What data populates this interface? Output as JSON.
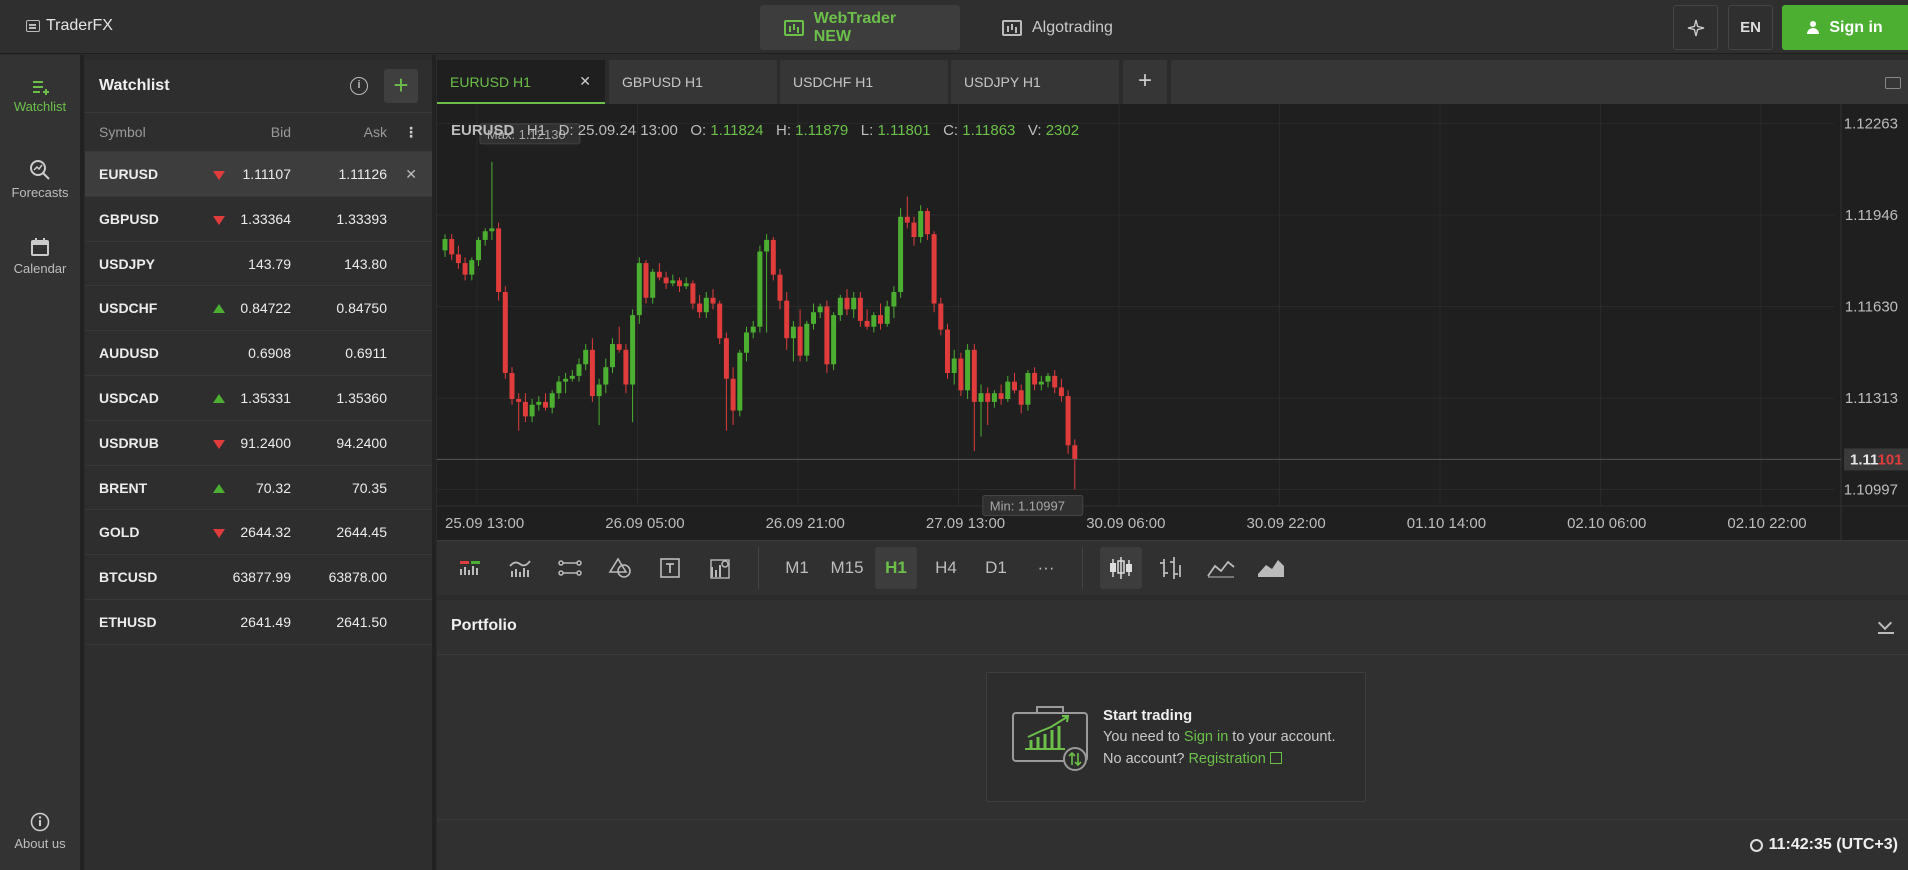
{
  "brand": {
    "name": "TraderFX"
  },
  "topnav": {
    "webtrader": "WebTrader NEW",
    "algotrading": "Algotrading"
  },
  "topbar": {
    "language": "EN",
    "signin": "Sign in"
  },
  "sidebar": {
    "items": [
      {
        "label": "Watchlist",
        "icon": "watchlist-icon",
        "active": true
      },
      {
        "label": "Forecasts",
        "icon": "search-chart-icon"
      },
      {
        "label": "Calendar",
        "icon": "calendar-icon"
      }
    ],
    "about": "About us"
  },
  "watchlist": {
    "title": "Watchlist",
    "columns": {
      "symbol": "Symbol",
      "bid": "Bid",
      "ask": "Ask"
    },
    "rows": [
      {
        "symbol": "EURUSD",
        "bid": "1.11107",
        "ask": "1.11126",
        "trend": "down"
      },
      {
        "symbol": "GBPUSD",
        "bid": "1.33364",
        "ask": "1.33393",
        "trend": "down"
      },
      {
        "symbol": "USDJPY",
        "bid": "143.79",
        "ask": "143.80",
        "trend": ""
      },
      {
        "symbol": "USDCHF",
        "bid": "0.84722",
        "ask": "0.84750",
        "trend": "up"
      },
      {
        "symbol": "AUDUSD",
        "bid": "0.6908",
        "ask": "0.6911",
        "trend": ""
      },
      {
        "symbol": "USDCAD",
        "bid": "1.35331",
        "ask": "1.35360",
        "trend": "up"
      },
      {
        "symbol": "USDRUB",
        "bid": "91.2400",
        "ask": "94.2400",
        "trend": "down"
      },
      {
        "symbol": "BRENT",
        "bid": "70.32",
        "ask": "70.35",
        "trend": "up"
      },
      {
        "symbol": "GOLD",
        "bid": "2644.32",
        "ask": "2644.45",
        "trend": "down"
      },
      {
        "symbol": "BTCUSD",
        "bid": "63877.99",
        "ask": "63878.00",
        "trend": ""
      },
      {
        "symbol": "ETHUSD",
        "bid": "2641.49",
        "ask": "2641.50",
        "trend": ""
      }
    ]
  },
  "tabs": [
    "EURUSD H1",
    "GBPUSD H1",
    "USDCHF H1",
    "USDJPY H1"
  ],
  "chart_info": {
    "symbol": "EURUSD",
    "tf": "H1",
    "date_label": "D:",
    "date": "25.09.24 13:00",
    "o_label": "O:",
    "o": "1.11824",
    "h_label": "H:",
    "h": "1.11879",
    "l_label": "L:",
    "l": "1.11801",
    "c_label": "C:",
    "c": "1.11863",
    "v_label": "V:",
    "v": "2302"
  },
  "chart_data": {
    "type": "candlestick",
    "y_ticks": [
      "1.12263",
      "1.11946",
      "1.11630",
      "1.11313",
      "1.10997"
    ],
    "ylim": [
      1.1094,
      1.1233
    ],
    "x_ticks": [
      "25.09 13:00",
      "26.09 05:00",
      "26.09 21:00",
      "27.09 13:00",
      "30.09 06:00",
      "30.09 22:00",
      "01.10 14:00",
      "02.10 06:00",
      "02.10 22:00"
    ],
    "max_label": "Max: 1.12130",
    "min_label": "Min: 1.10997",
    "max": 1.1213,
    "min": 1.10997,
    "current_price_prefix": "1.11",
    "current_price_suffix": "101",
    "current_price": 1.11101,
    "candles": [
      [
        1.11824,
        1.11879,
        1.11801,
        1.11863
      ],
      [
        1.11863,
        1.1188,
        1.1179,
        1.1181
      ],
      [
        1.1181,
        1.1184,
        1.1176,
        1.1178
      ],
      [
        1.1178,
        1.118,
        1.1172,
        1.1174
      ],
      [
        1.1174,
        1.118,
        1.1172,
        1.1179
      ],
      [
        1.1179,
        1.1187,
        1.1177,
        1.1186
      ],
      [
        1.1186,
        1.119,
        1.1184,
        1.1189
      ],
      [
        1.1189,
        1.1213,
        1.1186,
        1.119
      ],
      [
        1.119,
        1.1192,
        1.1165,
        1.1168
      ],
      [
        1.1168,
        1.117,
        1.1138,
        1.114
      ],
      [
        1.114,
        1.1142,
        1.1129,
        1.1131
      ],
      [
        1.1131,
        1.1133,
        1.112,
        1.113
      ],
      [
        1.113,
        1.1133,
        1.1123,
        1.1125
      ],
      [
        1.1125,
        1.1131,
        1.1123,
        1.1129
      ],
      [
        1.1129,
        1.1132,
        1.1127,
        1.113
      ],
      [
        1.113,
        1.1133,
        1.1127,
        1.1128
      ],
      [
        1.1128,
        1.1134,
        1.1126,
        1.1133
      ],
      [
        1.1133,
        1.1139,
        1.1131,
        1.1137
      ],
      [
        1.1137,
        1.114,
        1.1133,
        1.1138
      ],
      [
        1.1138,
        1.1141,
        1.1137,
        1.1139
      ],
      [
        1.1139,
        1.1145,
        1.1137,
        1.1143
      ],
      [
        1.1143,
        1.115,
        1.1141,
        1.1148
      ],
      [
        1.1148,
        1.1152,
        1.113,
        1.1132
      ],
      [
        1.1132,
        1.1138,
        1.1122,
        1.1136
      ],
      [
        1.1136,
        1.1145,
        1.1133,
        1.1142
      ],
      [
        1.1142,
        1.1152,
        1.114,
        1.115
      ],
      [
        1.115,
        1.1156,
        1.1147,
        1.1148
      ],
      [
        1.1148,
        1.115,
        1.1133,
        1.1136
      ],
      [
        1.1136,
        1.1162,
        1.1123,
        1.116
      ],
      [
        1.116,
        1.118,
        1.1157,
        1.1178
      ],
      [
        1.1178,
        1.1179,
        1.1164,
        1.1166
      ],
      [
        1.1166,
        1.1176,
        1.1164,
        1.1175
      ],
      [
        1.1175,
        1.1178,
        1.1172,
        1.1173
      ],
      [
        1.1173,
        1.1175,
        1.1169,
        1.1171
      ],
      [
        1.1171,
        1.1174,
        1.117,
        1.1172
      ],
      [
        1.1172,
        1.1173,
        1.1168,
        1.117
      ],
      [
        1.117,
        1.1173,
        1.1169,
        1.1171
      ],
      [
        1.1171,
        1.1172,
        1.1162,
        1.1164
      ],
      [
        1.1164,
        1.1167,
        1.1159,
        1.1161
      ],
      [
        1.1161,
        1.1168,
        1.1159,
        1.1166
      ],
      [
        1.1166,
        1.1169,
        1.1162,
        1.1164
      ],
      [
        1.1164,
        1.1165,
        1.115,
        1.1152
      ],
      [
        1.1152,
        1.1154,
        1.112,
        1.1138
      ],
      [
        1.1138,
        1.1142,
        1.1122,
        1.1127
      ],
      [
        1.1127,
        1.1148,
        1.1125,
        1.1147
      ],
      [
        1.1147,
        1.1156,
        1.1144,
        1.1154
      ],
      [
        1.1154,
        1.1158,
        1.1152,
        1.1156
      ],
      [
        1.1156,
        1.1184,
        1.1154,
        1.1182
      ],
      [
        1.1182,
        1.1188,
        1.1154,
        1.1186
      ],
      [
        1.1186,
        1.1187,
        1.1172,
        1.1174
      ],
      [
        1.1174,
        1.1176,
        1.1162,
        1.1165
      ],
      [
        1.1165,
        1.1168,
        1.1148,
        1.1152
      ],
      [
        1.1152,
        1.1158,
        1.1144,
        1.1156
      ],
      [
        1.1156,
        1.1162,
        1.1144,
        1.1146
      ],
      [
        1.1146,
        1.1158,
        1.1144,
        1.1157
      ],
      [
        1.1157,
        1.1164,
        1.1155,
        1.1161
      ],
      [
        1.1161,
        1.1164,
        1.1159,
        1.1163
      ],
      [
        1.1163,
        1.1165,
        1.114,
        1.1143
      ],
      [
        1.1143,
        1.1161,
        1.1141,
        1.116
      ],
      [
        1.116,
        1.1167,
        1.1158,
        1.1166
      ],
      [
        1.1166,
        1.1169,
        1.116,
        1.1162
      ],
      [
        1.1162,
        1.1168,
        1.1159,
        1.1166
      ],
      [
        1.1166,
        1.1168,
        1.1156,
        1.1158
      ],
      [
        1.1158,
        1.1162,
        1.1155,
        1.1156
      ],
      [
        1.1156,
        1.1161,
        1.1154,
        1.116
      ],
      [
        1.116,
        1.1164,
        1.1155,
        1.1157
      ],
      [
        1.1157,
        1.1165,
        1.1156,
        1.1163
      ],
      [
        1.1163,
        1.117,
        1.1159,
        1.1168
      ],
      [
        1.1168,
        1.1197,
        1.1166,
        1.1194
      ],
      [
        1.1194,
        1.1201,
        1.119,
        1.1192
      ],
      [
        1.1192,
        1.1194,
        1.1184,
        1.1187
      ],
      [
        1.1187,
        1.1198,
        1.1185,
        1.1196
      ],
      [
        1.1196,
        1.1197,
        1.1186,
        1.1188
      ],
      [
        1.1188,
        1.1189,
        1.1161,
        1.1164
      ],
      [
        1.1164,
        1.1166,
        1.1153,
        1.1155
      ],
      [
        1.1155,
        1.1157,
        1.1138,
        1.114
      ],
      [
        1.114,
        1.1148,
        1.1136,
        1.1145
      ],
      [
        1.1145,
        1.1147,
        1.1132,
        1.1134
      ],
      [
        1.1134,
        1.115,
        1.1131,
        1.1148
      ],
      [
        1.1148,
        1.115,
        1.1113,
        1.113
      ],
      [
        1.113,
        1.1136,
        1.1118,
        1.1133
      ],
      [
        1.1133,
        1.1135,
        1.1122,
        1.113
      ],
      [
        1.113,
        1.1134,
        1.1128,
        1.1133
      ],
      [
        1.1133,
        1.1136,
        1.1129,
        1.1131
      ],
      [
        1.1131,
        1.1139,
        1.113,
        1.1137
      ],
      [
        1.1137,
        1.114,
        1.1133,
        1.1134
      ],
      [
        1.1134,
        1.1136,
        1.1126,
        1.1129
      ],
      [
        1.1129,
        1.1141,
        1.1127,
        1.114
      ],
      [
        1.114,
        1.1142,
        1.1134,
        1.1136
      ],
      [
        1.1136,
        1.1139,
        1.1134,
        1.1137
      ],
      [
        1.1137,
        1.114,
        1.1135,
        1.1139
      ],
      [
        1.1139,
        1.1141,
        1.1133,
        1.1135
      ],
      [
        1.1135,
        1.1138,
        1.113,
        1.1132
      ],
      [
        1.1132,
        1.1134,
        1.1112,
        1.1115
      ],
      [
        1.1115,
        1.1117,
        1.10997,
        1.11101
      ]
    ]
  },
  "toolbar": {
    "indicator_icons": [
      "volume-icon",
      "indicators-icon",
      "line-tools-icon",
      "shapes-icon",
      "text-tool-icon",
      "settings-chart-icon"
    ],
    "timeframes": [
      "M1",
      "M15",
      "H1",
      "H4",
      "D1",
      "···"
    ],
    "active_timeframe": "H1"
  },
  "portfolio": {
    "title": "Portfolio",
    "card_title": "Start trading",
    "line1_a": "You need to",
    "line1_link": "Sign in",
    "line1_b": "to your account.",
    "line2_a": "No account?",
    "line2_link": "Registration"
  },
  "status": {
    "time": "11:42:35 (UTC+3)"
  },
  "colors": {
    "accent": "#4caf32",
    "accent_text": "#6cc04a",
    "up": "#4caf32",
    "down": "#e03c3c"
  }
}
